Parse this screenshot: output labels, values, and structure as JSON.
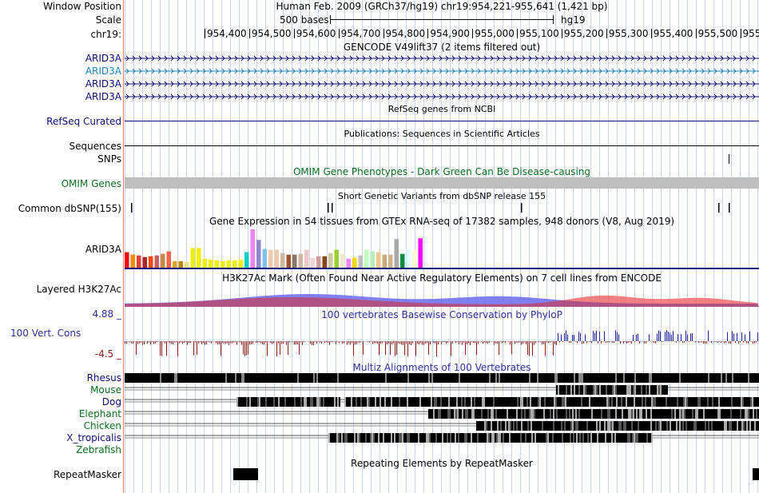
{
  "header": {
    "window_position_label": "Window Position",
    "assembly_title": "Human Feb. 2009 (GRCh37/hg19)   chr19:954,221-955,641 (1,421 bp)",
    "scale_label": "Scale",
    "scale_text": "500 bases",
    "scale_db": "hg19",
    "chrom_label": "chr19:",
    "ruler_ticks": [
      "954,400",
      "954,500",
      "954,600",
      "954,700",
      "954,800",
      "954,900",
      "955,000",
      "955,100",
      "955,200",
      "955,300",
      "955,400",
      "955,500",
      "955,600"
    ]
  },
  "tracks": {
    "gencode": {
      "title": "GENCODE V49lift37 (2 items filtered out)",
      "items": [
        "ARID3A",
        "ARID3A",
        "ARID3A",
        "ARID3A"
      ]
    },
    "refseq": {
      "title": "RefSeq genes from NCBI",
      "label": "RefSeq Curated"
    },
    "publications": {
      "title": "Publications: Sequences in Scientific Articles",
      "label_sequences": "Sequences",
      "label_snps": "SNPs"
    },
    "omim": {
      "title": "OMIM Gene Phenotypes - Dark Green Can Be Disease-causing",
      "label": "OMIM Genes"
    },
    "dbsnp": {
      "title": "Short Genetic Variants from dbSNP release 155",
      "label": "Common dbSNP(155)"
    },
    "gtex": {
      "title": "Gene Expression in 54 tissues from GTEx RNA-seq of 17382 samples, 948 donors (V8, Aug 2019)",
      "label": "ARID3A"
    },
    "h3k27ac": {
      "title": "H3K27Ac Mark (Often Found Near Active Regulatory Elements) on 7 cell lines from ENCODE",
      "label": "Layered H3K27Ac"
    },
    "phylop": {
      "title": "100 vertebrates Basewise Conservation by PhyloP",
      "label": "100 Vert. Cons",
      "max_label": "4.88 _",
      "min_label": "-4.5 _"
    },
    "multiz": {
      "title": "Multiz Alignments of 100 Vertebrates",
      "species": [
        {
          "name": "Rhesus",
          "color": "#0c0c78"
        },
        {
          "name": "Mouse",
          "color": "#0a6e1e"
        },
        {
          "name": "Dog",
          "color": "#0c0c78"
        },
        {
          "name": "Elephant",
          "color": "#0a6e1e"
        },
        {
          "name": "Chicken",
          "color": "#0a6e1e"
        },
        {
          "name": "X_tropicalis",
          "color": "#0c0c78"
        },
        {
          "name": "Zebrafish",
          "color": "#0a6e1e"
        }
      ]
    },
    "repeatmasker": {
      "title": "Repeating Elements by RepeatMasker",
      "label": "RepeatMasker"
    }
  },
  "colors": {
    "gene_blue": "#0c0c78",
    "omim_gray": "#bebebe",
    "h3k27ac_blue": "#6a6aee",
    "h3k27ac_red": "#ee6a6a",
    "phylop_red": "#8b1a1a",
    "phylop_blue": "#1a1a9a"
  },
  "gtex_values": [
    {
      "value": 19,
      "color": "#ff0000"
    },
    {
      "value": 16,
      "color": "#ff8c00"
    },
    {
      "value": 15,
      "color": "#e34234"
    },
    {
      "value": 13,
      "color": "#b22222"
    },
    {
      "value": 14,
      "color": "#ff4500"
    },
    {
      "value": 15,
      "color": "#cd5c5c"
    },
    {
      "value": 17,
      "color": "#cd853f"
    },
    {
      "value": 20,
      "color": "#ff6347"
    },
    {
      "value": 8,
      "color": "#daa520"
    },
    {
      "value": 8,
      "color": "#b8860b"
    },
    {
      "value": 7,
      "color": "#eedd82"
    },
    {
      "value": 24,
      "color": "#eeee00"
    },
    {
      "value": 24,
      "color": "#eeee00"
    },
    {
      "value": 11,
      "color": "#eeee00"
    },
    {
      "value": 10,
      "color": "#eeee00"
    },
    {
      "value": 9,
      "color": "#eeee00"
    },
    {
      "value": 8,
      "color": "#eeee00"
    },
    {
      "value": 9,
      "color": "#eeee00"
    },
    {
      "value": 9,
      "color": "#eeee00"
    },
    {
      "value": 10,
      "color": "#eeee00"
    },
    {
      "value": 19,
      "color": "#00cdcd"
    },
    {
      "value": 47,
      "color": "#ee82ee"
    },
    {
      "value": 34,
      "color": "#8b87cf"
    },
    {
      "value": 23,
      "color": "#7ec0ee"
    },
    {
      "value": 22,
      "color": "#eec9af"
    },
    {
      "value": 22,
      "color": "#eec9af"
    },
    {
      "value": 18,
      "color": "#cdb79e"
    },
    {
      "value": 16,
      "color": "#a0522d"
    },
    {
      "value": 16,
      "color": "#8b7765"
    },
    {
      "value": 17,
      "color": "#cdb79e"
    },
    {
      "value": 22,
      "color": "#eec5c5"
    },
    {
      "value": 12,
      "color": "#eed5d2"
    },
    {
      "value": 14,
      "color": "#cd9b9b"
    },
    {
      "value": 14,
      "color": "#8b4513"
    },
    {
      "value": 18,
      "color": "#cdc9a5"
    },
    {
      "value": 22,
      "color": "#9acd32"
    },
    {
      "value": 17,
      "color": "#eee8cd"
    },
    {
      "value": 11,
      "color": "#ff83fa"
    },
    {
      "value": 12,
      "color": "#ffd700"
    },
    {
      "value": 15,
      "color": "#bebebe"
    },
    {
      "value": 22,
      "color": "#c1ffc1"
    },
    {
      "value": 20,
      "color": "#b4eeb4"
    },
    {
      "value": 19,
      "color": "#eec591"
    },
    {
      "value": 16,
      "color": "#cdaa7d"
    },
    {
      "value": 16,
      "color": "#d2b48c"
    },
    {
      "value": 35,
      "color": "#a9a9a9"
    },
    {
      "value": 17,
      "color": "#008b45"
    },
    {
      "value": 23,
      "color": "#e0ffff"
    },
    {
      "value": 22,
      "color": "#fafad2"
    },
    {
      "value": 36,
      "color": "#ff00ff"
    }
  ]
}
